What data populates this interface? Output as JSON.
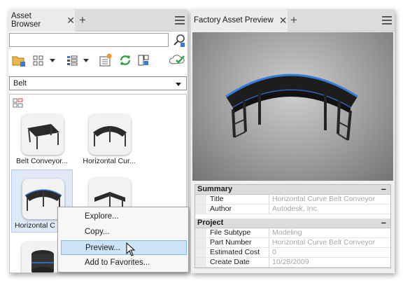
{
  "left_panel": {
    "tab_label": "Asset Browser",
    "close_glyph": "✕",
    "add_tab_glyph": "+",
    "search": {
      "value": "",
      "placeholder": ""
    },
    "category_value": "Belt",
    "tiles": [
      {
        "label": "Belt Conveyor..."
      },
      {
        "label": "Horizontal Cur..."
      },
      {
        "label": "Horizontal C"
      },
      {
        "label": ""
      },
      {
        "label": ""
      }
    ],
    "context_menu": {
      "items": [
        "Explore...",
        "Copy...",
        "Preview...",
        "Add to Favorites..."
      ]
    }
  },
  "right_panel": {
    "tab_label": "Factory Asset Preview",
    "close_glyph": "✕",
    "add_tab_glyph": "+",
    "sections": [
      {
        "title": "Summary",
        "toggle": "–",
        "rows": [
          {
            "key": "Title",
            "value": "Horizontal Curve Belt Conveyor"
          },
          {
            "key": "Author",
            "value": "Autodesk, Inc."
          }
        ]
      },
      {
        "title": "Project",
        "toggle": "–",
        "rows": [
          {
            "key": "File Subtype",
            "value": "Modeling"
          },
          {
            "key": "Part Number",
            "value": "Horizontal Curve Belt Conveyor"
          },
          {
            "key": "Estimated Cost",
            "value": "0"
          },
          {
            "key": "Create Date",
            "value": "10/28/2009"
          }
        ]
      }
    ]
  },
  "icons": {
    "search": "magnifier-icon",
    "folder": "folder-add-icon",
    "grid": "grid-view-icon",
    "list": "list-view-icon",
    "import": "import-icon",
    "refresh": "refresh-icon",
    "library": "library-icon",
    "cloud": "cloud-check-icon",
    "group": "asset-group-icon",
    "cursor": "mouse-pointer-icon"
  },
  "colors": {
    "selection": "#dfe9f7",
    "menu_highlight": "#cde4f8",
    "refresh_green": "#2aa33a",
    "belt_blue": "#3a7ad8",
    "property_value_gray": "#a8a8a8"
  }
}
